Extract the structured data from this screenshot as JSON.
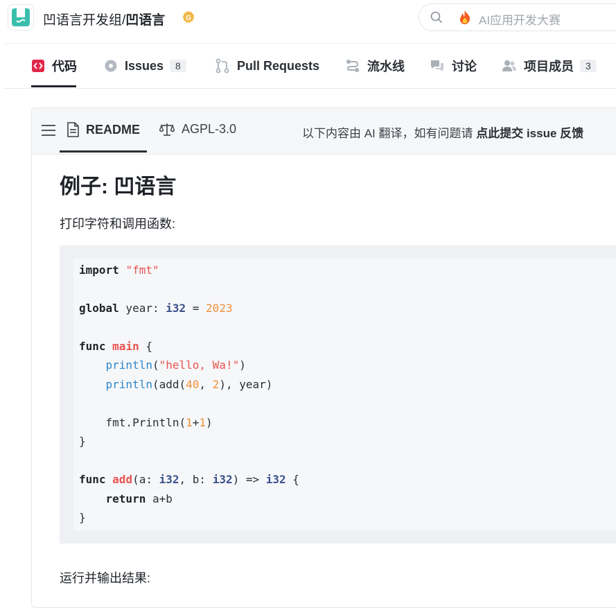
{
  "header": {
    "org": "凹语言开发组",
    "separator": "/",
    "repo_name": "凹语言",
    "search_placeholder": "AI应用开发大赛"
  },
  "repo_nav": {
    "tabs": [
      {
        "label": "代码",
        "icon": "code-icon",
        "active": true
      },
      {
        "label": "Issues",
        "icon": "issues-icon",
        "count": "8"
      },
      {
        "label": "Pull Requests",
        "icon": "pull-request-icon"
      },
      {
        "label": "流水线",
        "icon": "pipeline-icon"
      },
      {
        "label": "讨论",
        "icon": "discussion-icon"
      },
      {
        "label": "项目成员",
        "icon": "members-icon",
        "count": "3"
      }
    ]
  },
  "readme_header": {
    "readme_tab": "README",
    "license_tab": "AGPL-3.0",
    "translate_note": "以下内容由 AI 翻译，如有问题请 ",
    "translate_link": "点此提交 issue 反馈"
  },
  "content": {
    "heading": "例子: 凹语言",
    "intro": "打印字符和调用函数:",
    "outro": "运行并输出结果:"
  },
  "colors": {
    "accent": "#e0284a",
    "keyword_string": "#e8534f",
    "number": "#f0903a",
    "type": "#39508a",
    "call": "#2f88c9"
  }
}
